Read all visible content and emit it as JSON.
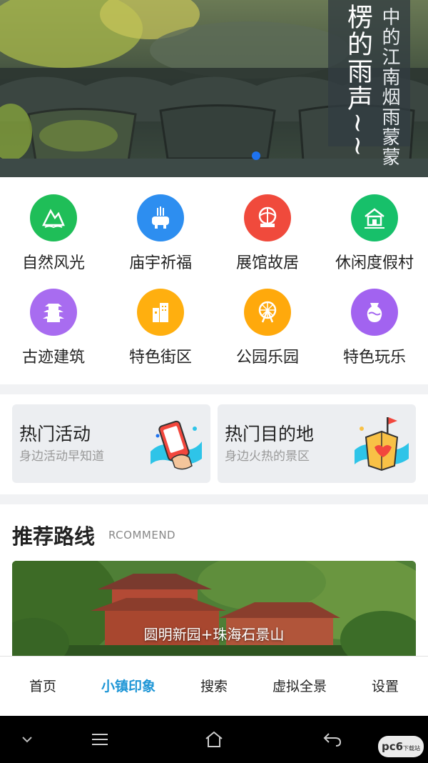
{
  "banner": {
    "col_big": "楞的雨声~~",
    "col_1": "中的江南",
    "col_2": "烟雨蒙蒙"
  },
  "categories": [
    {
      "label": "自然风光",
      "icon": "mountain-icon",
      "color": "#1fbe58"
    },
    {
      "label": "庙宇祈福",
      "icon": "incense-burner-icon",
      "color": "#2d8ef0"
    },
    {
      "label": "展馆故居",
      "icon": "pavilion-icon",
      "color": "#f04a3c"
    },
    {
      "label": "休闲度假村",
      "icon": "resort-icon",
      "color": "#17c06a"
    },
    {
      "label": "古迹建筑",
      "icon": "pagoda-icon",
      "color": "#a86cf0"
    },
    {
      "label": "特色街区",
      "icon": "street-building-icon",
      "color": "#ffaf0f"
    },
    {
      "label": "公园乐园",
      "icon": "ferris-wheel-icon",
      "color": "#ffa90c"
    },
    {
      "label": "特色玩乐",
      "icon": "vase-icon",
      "color": "#a263f0"
    }
  ],
  "hot": {
    "activity_title": "热门活动",
    "activity_sub": "身边活动早知道",
    "destination_title": "热门目的地",
    "destination_sub": "身边火热的景区"
  },
  "recommend": {
    "title": "推荐路线",
    "subtitle": "RCOMMEND",
    "caption": "圆明新园+珠海石景山"
  },
  "tabs": [
    {
      "label": "首页",
      "active": false
    },
    {
      "label": "小镇印象",
      "active": true
    },
    {
      "label": "搜索",
      "active": false
    },
    {
      "label": "虚拟全景",
      "active": false
    },
    {
      "label": "设置",
      "active": false
    }
  ],
  "watermark": {
    "main": "pc6",
    "sub": "下载站"
  },
  "colors": {
    "accent": "#1e96d6",
    "banner_dot": "#1e73f0"
  }
}
